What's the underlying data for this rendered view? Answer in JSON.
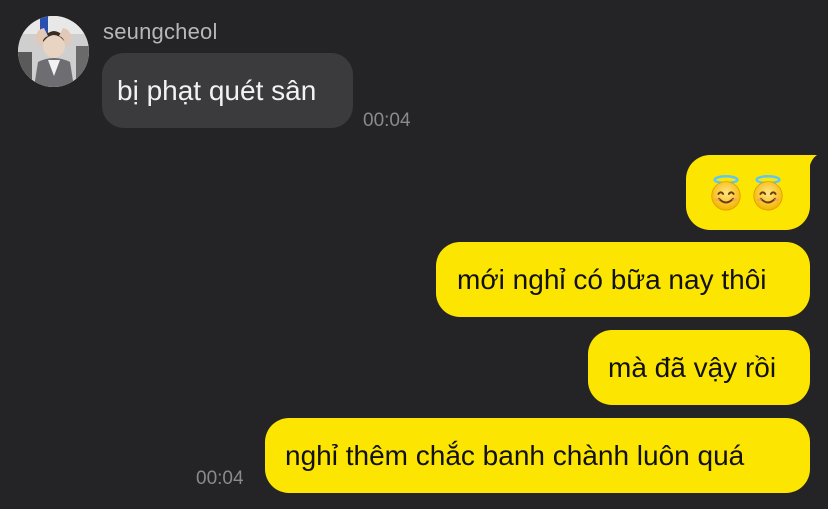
{
  "conversation": {
    "incoming": {
      "sender": "seungcheol",
      "message": "bị phạt quét sân",
      "time": "00:04"
    },
    "outgoing": {
      "emoji_message": [
        "halo-smile-emoji",
        "halo-smile-emoji"
      ],
      "messages": [
        "mới nghỉ có bữa nay thôi",
        "mà đã vậy rồi",
        "nghỉ thêm chắc banh chành luôn quá"
      ],
      "time": "00:04"
    }
  },
  "colors": {
    "background": "#242426",
    "incoming_bubble": "#3b3b3d",
    "outgoing_bubble": "#fce500"
  }
}
